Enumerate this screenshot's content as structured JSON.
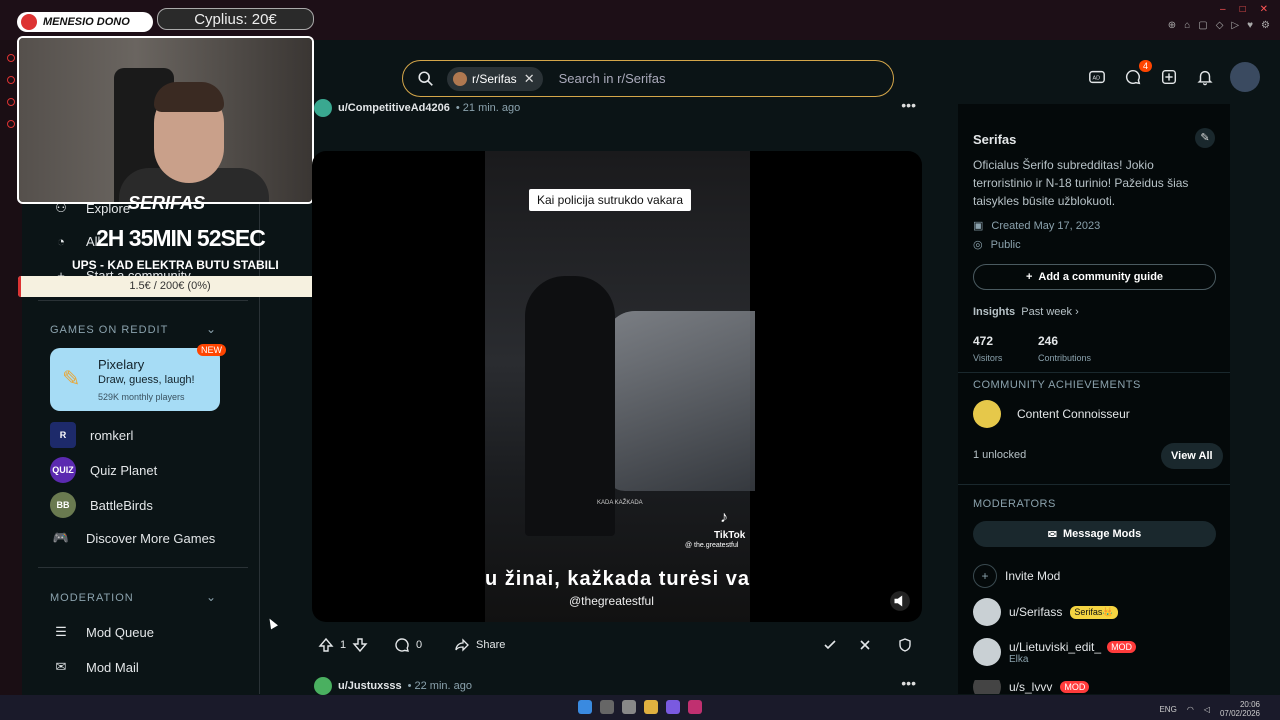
{
  "stream": {
    "donor_name": "MENESIO DONO",
    "donor_amount": "Cyplius: 20€",
    "streamer_name": "SERIFAS",
    "timer": "2H 35MIN 52SEC",
    "goal_title": "UPS - KAD ELEKTRA BUTU STABILI",
    "goal_progress": "1.5€ / 200€ (0%)",
    "goal_fraction": 0.0075
  },
  "header": {
    "search_chip": "r/Serifas",
    "search_placeholder": "Search in r/Serifas",
    "chat_badge": "4"
  },
  "sidebar": {
    "explore": "Explore",
    "all": "All",
    "start_community": "Start a community",
    "games_label": "GAMES ON REDDIT",
    "game_card": {
      "title": "Pixelary",
      "desc": "Draw, guess, laugh!",
      "players": "529K monthly players",
      "badge": "NEW"
    },
    "games": [
      {
        "label": "romkerl",
        "icon": "R"
      },
      {
        "label": "Quiz Planet",
        "icon": "QUIZ"
      },
      {
        "label": "BattleBirds",
        "icon": "BB"
      },
      {
        "label": "Discover More Games",
        "icon": ""
      }
    ],
    "moderation_label": "MODERATION",
    "mod_queue": "Mod Queue",
    "mod_mail": "Mod Mail"
  },
  "posts": [
    {
      "user": "u/CompetitiveAd4206",
      "time": "• 21 min. ago",
      "caption": "Kai policija sutrukdo vakara",
      "subtitle": "u žinai, kažkada turėsi va",
      "handle": "@thegreatestful",
      "tiktok": "TikTok",
      "tiktok_handle": "@ the.greatestful",
      "watermark": "KADA KAŽKADA",
      "upvotes": "1",
      "comments": "0",
      "share": "Share"
    },
    {
      "user": "u/Justuxsss",
      "time": "• 22 min. ago"
    }
  ],
  "community": {
    "name": "Serifas",
    "description": "Oficialus Šerifo subredditas! Jokio terroristinio ir N-18 turinio! Pažeidus šias taisykles būsite užblokuoti.",
    "created": "Created May 17, 2023",
    "visibility": "Public",
    "guide_button": "Add a community guide",
    "insights": "Insights",
    "insights_range": "Past week ›",
    "visitors": "472",
    "visitors_label": "Visitors",
    "contributions": "246",
    "contributions_label": "Contributions",
    "achievements_label": "COMMUNITY ACHIEVEMENTS",
    "achievement": "Content Connoisseur",
    "unlocked": "1 unlocked",
    "view_all": "View All",
    "moderators_label": "MODERATORS",
    "message_mods": "Message Mods",
    "invite_mod": "Invite Mod",
    "mods": [
      {
        "name": "u/Serifass",
        "flair": "Serifas👑",
        "flair_color": "#f5d442"
      },
      {
        "name": "u/Lietuviski_edit_",
        "flair": "MOD",
        "flair_color": "#ff3b3b",
        "sub": "Elka"
      },
      {
        "name": "u/s_lvvv",
        "flair": "MOD",
        "flair_color": "#ff3b3b"
      }
    ]
  },
  "taskbar": {
    "lang": "ENG",
    "time": "20:06",
    "date": "07/02/2026"
  }
}
